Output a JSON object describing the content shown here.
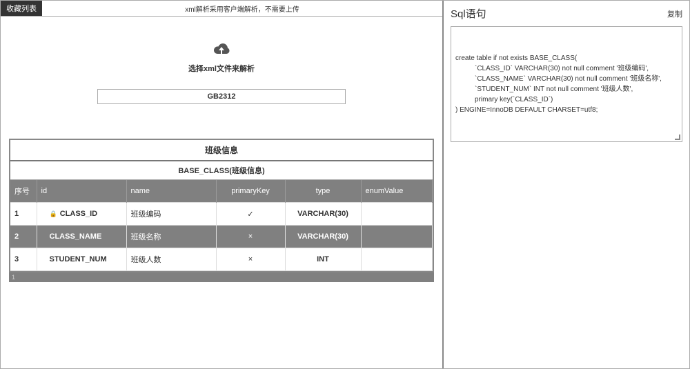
{
  "topbar": {
    "fav_button": "收藏列表",
    "notice": "xml解析采用客户端解析，不需要上传"
  },
  "upload": {
    "label": "选择xml文件来解析"
  },
  "encoding": {
    "value": "GB2312"
  },
  "tableBlock": {
    "title": "班级信息",
    "tableName": "BASE_CLASS(班级信息)"
  },
  "columns": {
    "idx": "序号",
    "id": "id",
    "name": "name",
    "primaryKey": "primaryKey",
    "type": "type",
    "enumValue": "enumValue"
  },
  "rows": [
    {
      "idx": "1",
      "id": "CLASS_ID",
      "name": "班级编码",
      "pk": "✓",
      "type": "VARCHAR(30)",
      "enum": "",
      "lock": true,
      "selected": false
    },
    {
      "idx": "2",
      "id": "CLASS_NAME",
      "name": "班级名称",
      "pk": "×",
      "type": "VARCHAR(30)",
      "enum": "",
      "lock": false,
      "selected": true
    },
    {
      "idx": "3",
      "id": "STUDENT_NUM",
      "name": "班级人数",
      "pk": "×",
      "type": "INT",
      "enum": "",
      "lock": false,
      "selected": false
    }
  ],
  "footerMark": "1",
  "sqlPanel": {
    "title": "Sql语句",
    "copy": "复制",
    "lines": [
      "create table if not exists BASE_CLASS(",
      "`CLASS_ID` VARCHAR(30) not null comment '班级编码',",
      "`CLASS_NAME` VARCHAR(30) not null comment '班级名称',",
      "`STUDENT_NUM` INT not null comment '班级人数',",
      "primary key(`CLASS_ID`)",
      ") ENGINE=InnoDB DEFAULT CHARSET=utf8;"
    ]
  }
}
